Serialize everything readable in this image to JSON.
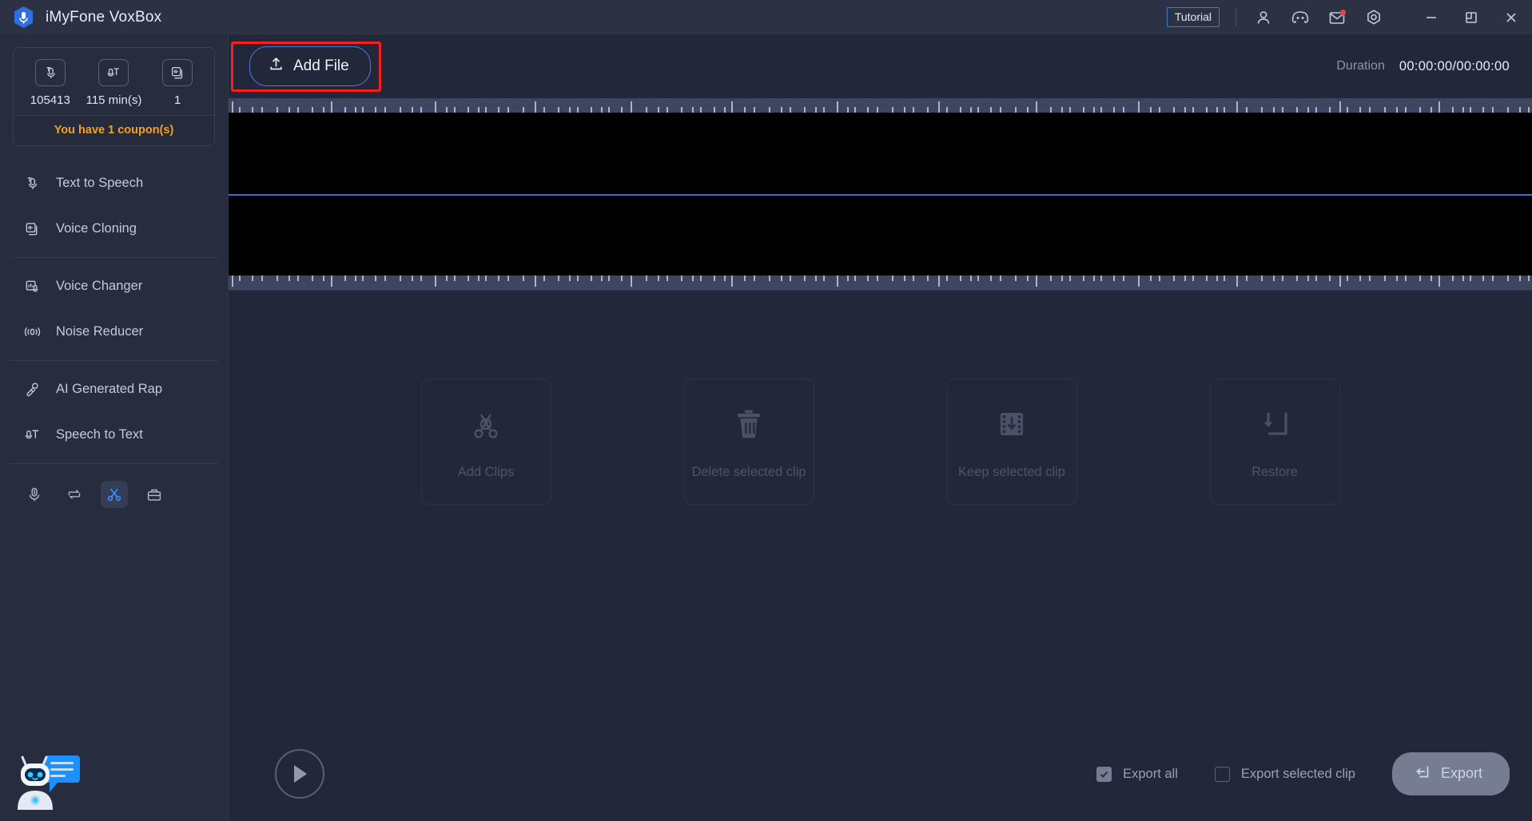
{
  "window": {
    "title": "iMyFone VoxBox",
    "logo_icon": "voxbox-microphone-logo",
    "tutorial_label": "Tutorial",
    "icons": [
      {
        "name": "account-icon",
        "glyph": "person"
      },
      {
        "name": "discord-icon",
        "glyph": "discord"
      },
      {
        "name": "mail-icon",
        "glyph": "envelope",
        "badge": true
      },
      {
        "name": "settings-icon",
        "glyph": "gear"
      },
      {
        "name": "minimize-icon",
        "glyph": "minus"
      },
      {
        "name": "maximize-icon",
        "glyph": "restore"
      },
      {
        "name": "close-icon",
        "glyph": "x"
      }
    ]
  },
  "sidebar": {
    "stats": [
      {
        "icon": "text-to-speech-icon",
        "value": "105413"
      },
      {
        "icon": "speech-to-text-icon",
        "value": "115 min(s)"
      },
      {
        "icon": "voice-cloning-icon",
        "value": "1"
      }
    ],
    "coupon_text": "You have 1 coupon(s)",
    "items": [
      {
        "label": "Text to Speech",
        "icon": "text-to-speech-icon"
      },
      {
        "label": "Voice Cloning",
        "icon": "voice-cloning-icon"
      },
      {
        "label": "Voice Changer",
        "icon": "voice-changer-icon"
      },
      {
        "label": "Noise Reducer",
        "icon": "noise-reducer-icon"
      },
      {
        "label": "AI Generated Rap",
        "icon": "ai-rap-icon"
      },
      {
        "label": "Speech to Text",
        "icon": "speech-to-text-icon"
      }
    ],
    "tools": [
      {
        "name": "recorder-icon",
        "active": false
      },
      {
        "name": "converter-icon",
        "active": false
      },
      {
        "name": "cutter-scissors-icon",
        "active": true
      },
      {
        "name": "toolbox-icon",
        "active": false
      }
    ],
    "mascot_icon": "chat-assistant-robot-icon"
  },
  "toolbar": {
    "add_file_label": "Add File",
    "add_file_icon": "upload-icon",
    "highlight_color": "#fc1e1e",
    "duration_label": "Duration",
    "duration_value": "00:00:00/00:00:00"
  },
  "waveform": {
    "playhead_color": "#2f6fe0",
    "background": "#000000",
    "ruler_background": "#3e455e"
  },
  "clip_actions": [
    {
      "label": "Add Clips",
      "icon": "scissors-x-icon"
    },
    {
      "label": "Delete selected clip",
      "icon": "trash-icon"
    },
    {
      "label": "Keep selected clip",
      "icon": "film-down-arrow-icon"
    },
    {
      "label": "Restore",
      "icon": "restore-arrow-icon"
    }
  ],
  "bottom": {
    "play_icon": "play-icon",
    "export_all_label": "Export all",
    "export_all_checked": true,
    "export_selected_label": "Export selected clip",
    "export_selected_checked": false,
    "export_button_label": "Export",
    "export_button_icon": "export-icon"
  }
}
